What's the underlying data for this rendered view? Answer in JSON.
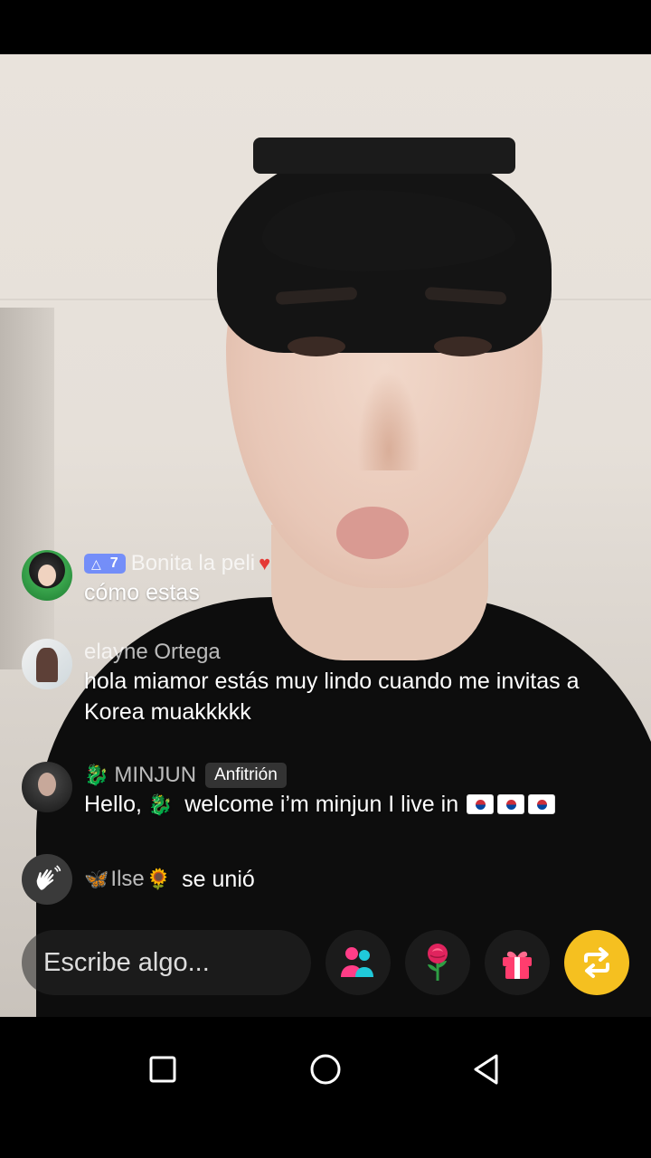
{
  "comments": [
    {
      "level": "7",
      "name": "Bonita la peli",
      "text": "cómo estas",
      "avatar_icon": "avatar-glasses-girl"
    },
    {
      "name": "elayne Ortega",
      "text": "hola  miamor estás muy lindo cuando me invitas a Korea muakkkkk",
      "avatar_icon": "avatar-photo"
    },
    {
      "name": "MINJUN",
      "badge": "Anfitrión",
      "text_before": "Hello, ",
      "text_after": " welcome i’m minjun I live in ",
      "avatar_icon": "avatar-host"
    }
  ],
  "joined": {
    "name": "Ilse",
    "text": "se unió"
  },
  "input": {
    "placeholder": "Escribe algo..."
  },
  "actions": [
    {
      "icon": "people-icon"
    },
    {
      "icon": "rose-icon"
    },
    {
      "icon": "gift-icon"
    },
    {
      "icon": "share-icon",
      "color": "#f5c020"
    }
  ],
  "colors": {
    "level_badge": "#6080ff",
    "share_button": "#f5c020"
  }
}
